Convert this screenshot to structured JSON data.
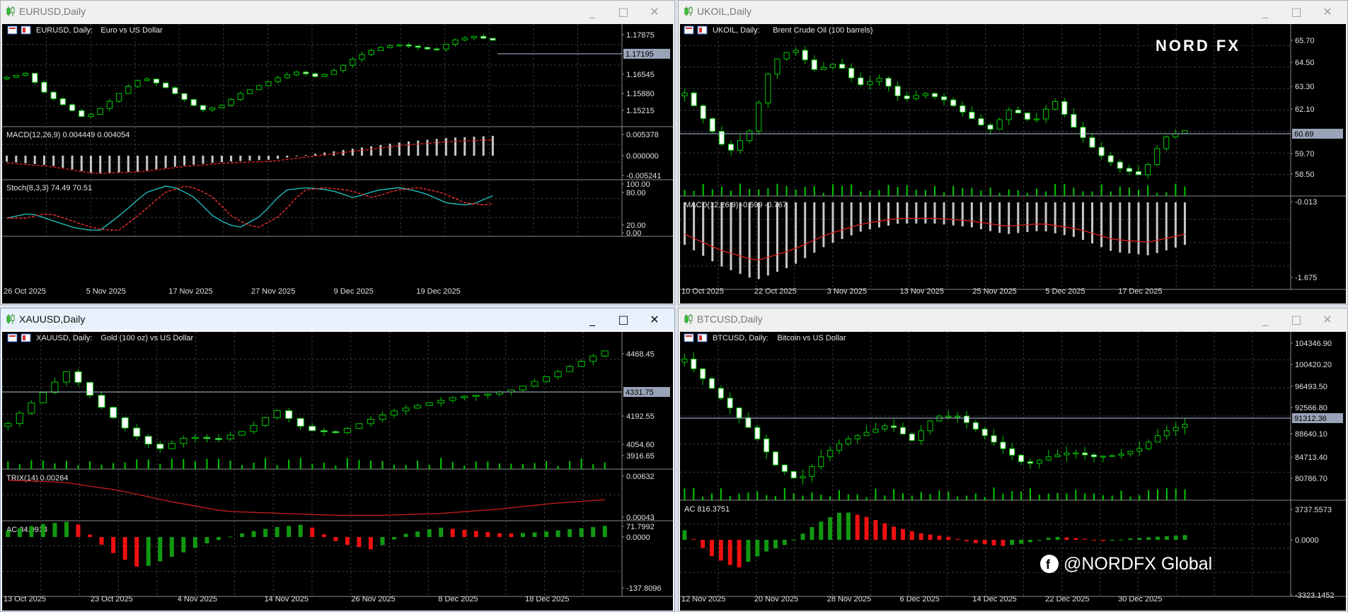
{
  "colors": {
    "bg": "#000000",
    "grid": "#3a3a3a",
    "bull": "#00c800",
    "bear": "#ffffff",
    "macd_line": "#e02020",
    "stoch_main": "#21c8c8",
    "stoch_signal": "#ff3030",
    "trix": "#c81e1e",
    "ac_up": "#119911",
    "ac_down": "#ee1111",
    "axis_text": "#e0e0e0",
    "price_line": "#b0c4de"
  },
  "icons": {
    "window": "candlestick-chart-icon",
    "header": "calendar-flag-icon",
    "minimize": "minimize-icon",
    "maximize": "maximize-icon",
    "close": "close-icon"
  },
  "windows": [
    {
      "title": "EURUSD,Daily",
      "active": false,
      "header": {
        "symbol": "EURUSD, Daily:",
        "desc": "Euro vs US Dollar"
      },
      "price_labels": [
        "1.17875",
        "1.17195",
        "1.16545",
        "1.15880",
        "1.15215"
      ],
      "current_price": "1.17195",
      "dates": [
        "26 Oct 2025",
        "5 Nov 2025",
        "17 Nov 2025",
        "27 Nov 2025",
        "9 Dec 2025",
        "19 Dec 2025"
      ],
      "sub1": {
        "label": "MACD(12,26,9) 0.004449 0.004054",
        "scale": [
          "0.005378",
          "0.000000",
          "-0.005241"
        ]
      },
      "sub2": {
        "label": "Stoch(8,3,3) 74.49 70.51",
        "scale": [
          "100.00",
          "80.00",
          "20.00",
          "0.00"
        ]
      }
    },
    {
      "title": "UKOIL,Daily",
      "active": false,
      "header": {
        "symbol": "UKOIL, Daily:",
        "desc": "Brent Crude Oil (100 barrels)"
      },
      "logo": "NORD FX",
      "price_labels": [
        "65.70",
        "64.50",
        "63.30",
        "62.10",
        "60.69",
        "59.70",
        "58.50"
      ],
      "current_price": "60.69",
      "dates": [
        "10 Oct 2025",
        "22 Oct 2025",
        "3 Nov 2025",
        "13 Nov 2025",
        "25 Nov 2025",
        "5 Dec 2025",
        "17 Dec 2025"
      ],
      "sub1": {
        "label": "MACD(12,26,9) -0.599 -0.767",
        "scale": [
          "-0.013",
          "-1.675"
        ]
      }
    },
    {
      "title": "XAUUSD,Daily",
      "active": true,
      "header": {
        "symbol": "XAUUSD, Daily:",
        "desc": "Gold (100 oz) vs US Dollar"
      },
      "price_labels": [
        "4468.45",
        "4331.75",
        "4192.55",
        "4054.60",
        "3916.65"
      ],
      "current_price": "4331.75",
      "dates": [
        "13 Oct 2025",
        "23 Oct 2025",
        "4 Nov 2025",
        "14 Nov 2025",
        "26 Nov 2025",
        "8 Dec 2025",
        "18 Dec 2025"
      ],
      "sub1": {
        "label": "TRIX(14) 0.00264",
        "scale": [
          "0.00632",
          "0.00043"
        ]
      },
      "sub2": {
        "label": "AC 34.0914",
        "scale": [
          "71.7992",
          "0.0000",
          "-137.8096"
        ]
      }
    },
    {
      "title": "BTCUSD,Daily",
      "active": false,
      "header": {
        "symbol": "BTCUSD, Daily:",
        "desc": "Bitcoin vs US Dollar"
      },
      "social": "@NORDFX Global",
      "price_labels": [
        "104346.90",
        "100420.20",
        "96493.50",
        "92566.80",
        "91312.36",
        "88640.10",
        "84713.40",
        "80786.70"
      ],
      "current_price": "91312.36",
      "dates": [
        "12 Nov 2025",
        "20 Nov 2025",
        "28 Nov 2025",
        "6 Dec 2025",
        "14 Dec 2025",
        "22 Dec 2025",
        "30 Dec 2025"
      ],
      "sub1": {
        "label": "AC 816.3751",
        "scale": [
          "3737.5573",
          "0.0000",
          "-3323.1452"
        ]
      }
    }
  ]
}
